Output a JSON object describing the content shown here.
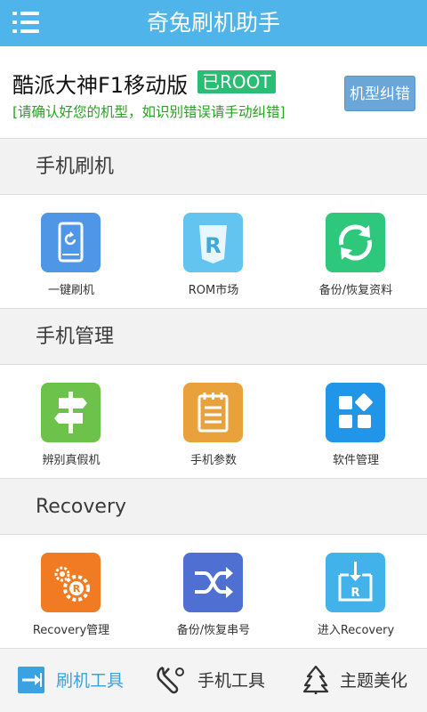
{
  "header": {
    "title": "奇兔刷机助手",
    "menu_icon": "menu-icon",
    "bg_color": "#4fb4ea"
  },
  "device": {
    "name": "酷派大神F1移动版",
    "root_badge": "已ROOT",
    "hint": "[请确认好您的机型，如识别错误请手动纠错]",
    "correct_button": "机型纠错"
  },
  "sections": [
    {
      "title": "手机刷机",
      "items": [
        {
          "label": "一键刷机",
          "icon": "phone-flash-icon",
          "color": "#4f97e6"
        },
        {
          "label": "ROM市场",
          "icon": "rom-market-icon",
          "color": "#63c4ef"
        },
        {
          "label": "备份/恢复资料",
          "icon": "sync-icon",
          "color": "#2ec87c"
        }
      ]
    },
    {
      "title": "手机管理",
      "items": [
        {
          "label": "辨别真假机",
          "icon": "signpost-icon",
          "color": "#6cc24a"
        },
        {
          "label": "手机参数",
          "icon": "notepad-icon",
          "color": "#e9a23b"
        },
        {
          "label": "软件管理",
          "icon": "apps-grid-icon",
          "color": "#2196e8"
        }
      ]
    },
    {
      "title": "Recovery",
      "items": [
        {
          "label": "Recovery管理",
          "icon": "recovery-gear-icon",
          "color": "#f07b23"
        },
        {
          "label": "备份/恢复串号",
          "icon": "shuffle-icon",
          "color": "#4f6fd2"
        },
        {
          "label": "进入Recovery",
          "icon": "enter-recovery-icon",
          "color": "#42b3ea"
        }
      ]
    }
  ],
  "tabbar": {
    "tabs": [
      {
        "label": "刷机工具",
        "icon": "flash-tool-icon",
        "active": true
      },
      {
        "label": "手机工具",
        "icon": "wrench-icon",
        "active": false
      },
      {
        "label": "主题美化",
        "icon": "tree-icon",
        "active": false
      }
    ],
    "active_color": "#3aa2e0",
    "inactive_color": "#333333"
  }
}
